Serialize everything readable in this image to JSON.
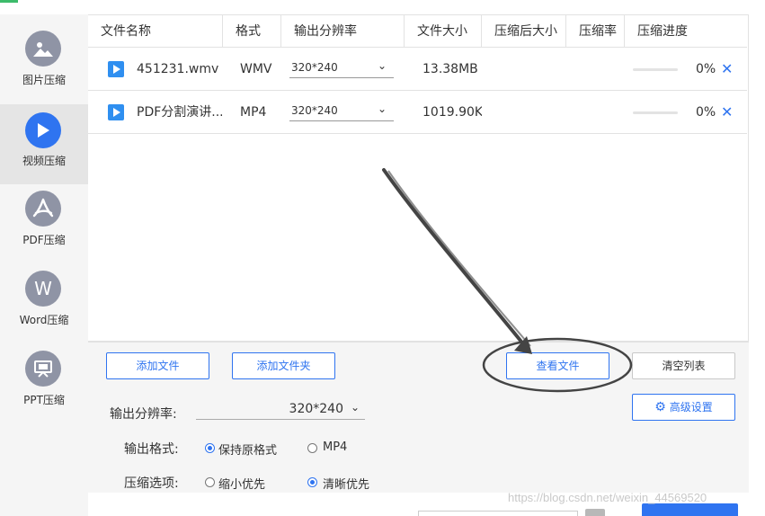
{
  "sidebar": {
    "items": [
      {
        "label": "图片压缩",
        "icon": "image-icon"
      },
      {
        "label": "视频压缩",
        "icon": "play-icon",
        "active": true
      },
      {
        "label": "PDF压缩",
        "icon": "pdf-icon"
      },
      {
        "label": "Word压缩",
        "icon": "word-icon",
        "glyph": "W"
      },
      {
        "label": "PPT压缩",
        "icon": "ppt-icon"
      }
    ]
  },
  "table": {
    "columns": [
      "文件名称",
      "格式",
      "输出分辨率",
      "文件大小",
      "压缩后大小",
      "压缩率",
      "压缩进度"
    ],
    "rows": [
      {
        "name": "451231.wmv",
        "format": "WMV",
        "resolution": "320*240",
        "size": "13.38MB",
        "progress": "0%",
        "progress_value": 0
      },
      {
        "name": "PDF分割演讲...",
        "format": "MP4",
        "resolution": "320*240",
        "size": "1019.90KB",
        "progress": "0%",
        "progress_value": 0
      }
    ]
  },
  "buttons": {
    "add_file": "添加文件",
    "add_folder": "添加文件夹",
    "view_file": "查看文件",
    "clear_list": "清空列表",
    "advanced": "高级设置"
  },
  "settings": {
    "output_resolution_label": "输出分辨率:",
    "output_resolution_value": "320*240",
    "output_format_label": "输出格式:",
    "format_options": [
      {
        "label": "保持原格式",
        "checked": true
      },
      {
        "label": "MP4",
        "checked": false
      }
    ],
    "compress_option_label": "压缩选项:",
    "compress_options": [
      {
        "label": "缩小优先",
        "checked": false
      },
      {
        "label": "清晰优先",
        "checked": true
      }
    ]
  },
  "watermark": "https://blog.csdn.net/weixin_44569520",
  "colors": {
    "accent": "#2f74f0",
    "sidebar_bg": "#f5f5f5",
    "annotation": "#444444"
  }
}
